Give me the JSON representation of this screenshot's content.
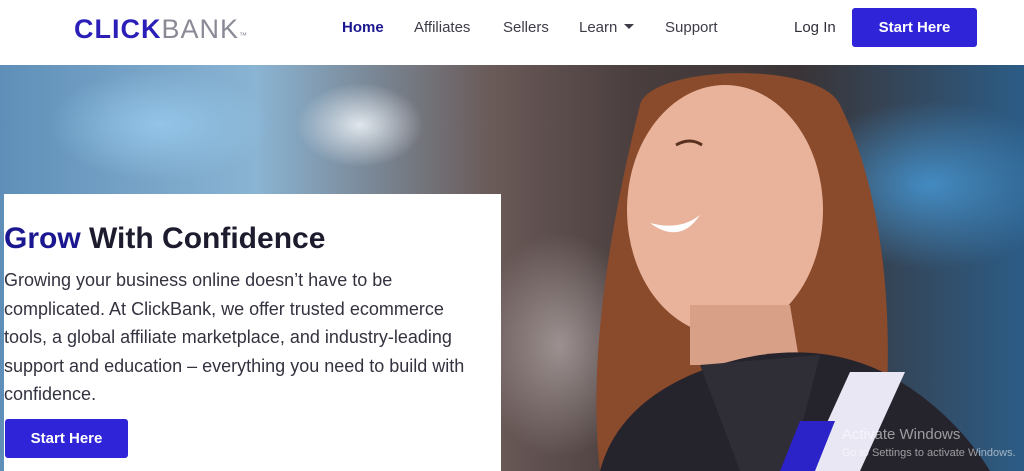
{
  "header": {
    "logo": {
      "primary": "CLICK",
      "secondary": "BANK",
      "mark": "™"
    },
    "nav": [
      {
        "label": "Home",
        "active": true
      },
      {
        "label": "Affiliates",
        "active": false
      },
      {
        "label": "Sellers",
        "active": false
      },
      {
        "label": "Learn",
        "active": false,
        "has_dropdown": true
      },
      {
        "label": "Support",
        "active": false
      }
    ],
    "login_label": "Log In",
    "cta_label": "Start Here"
  },
  "hero": {
    "title_accent": "Grow",
    "title_rest": " With Confidence",
    "body": "Growing your business online doesn’t have to be complicated. At ClickBank, we offer trusted ecommerce tools, a global affiliate marketplace, and industry-leading support and education – everything you need to build with confidence.",
    "cta_label": "Start Here",
    "image_description_icon": "hero-photo"
  },
  "watermark": {
    "title": "Activate Windows",
    "subtitle": "Go to Settings to activate Windows."
  },
  "colors": {
    "brand": "#2b1fb8",
    "nav_active": "#1a1790",
    "button": "#2f24d8",
    "text": "#333340"
  }
}
